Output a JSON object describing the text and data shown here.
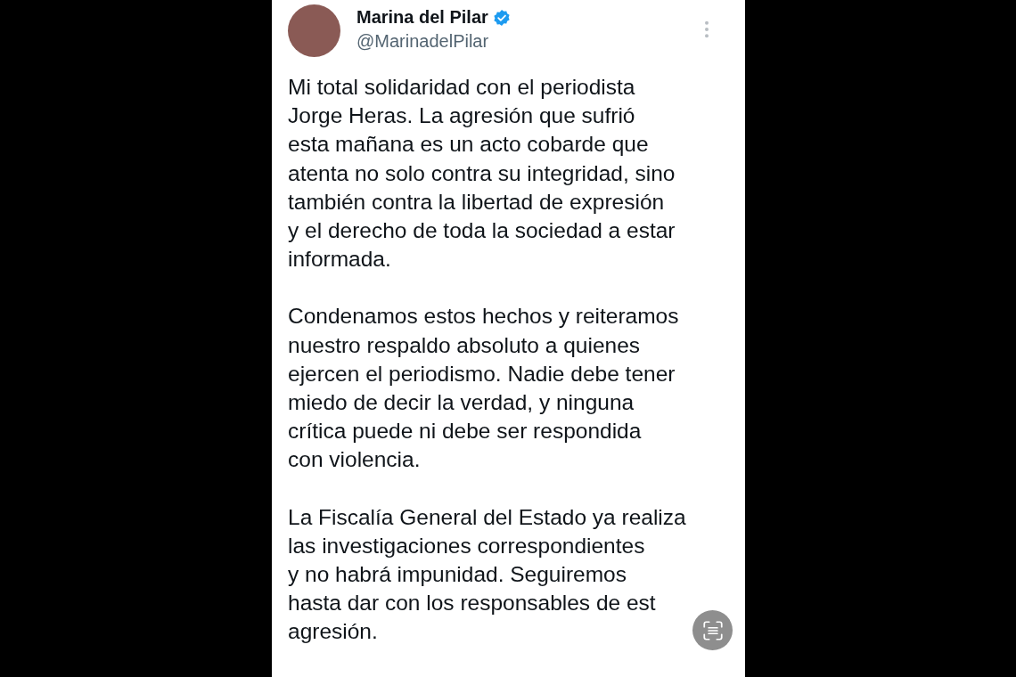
{
  "author": {
    "name": "Marina del Pilar",
    "verified": true,
    "handle": "@MarinadelPilar"
  },
  "paragraphs": [
    [
      "Mi total solidaridad con el periodista",
      "Jorge Heras. La agresión que sufrió",
      "esta mañana es un acto cobarde que",
      "atenta no solo contra su integridad, sino",
      "también contra la libertad de expresión",
      "y el derecho de toda la sociedad a estar",
      "informada."
    ],
    [
      "Condenamos estos hechos y reiteramos",
      "nuestro respaldo absoluto a quienes",
      "ejercen el periodismo. Nadie debe tener",
      "miedo de decir la verdad, y ninguna",
      "crítica puede ni debe ser respondida",
      "con violencia."
    ],
    [
      "La Fiscalía General del Estado ya realiza",
      "las investigaciones correspondientes",
      "y no habrá impunidad. Seguiremos",
      "hasta dar con los responsables de est",
      "agresión."
    ]
  ]
}
